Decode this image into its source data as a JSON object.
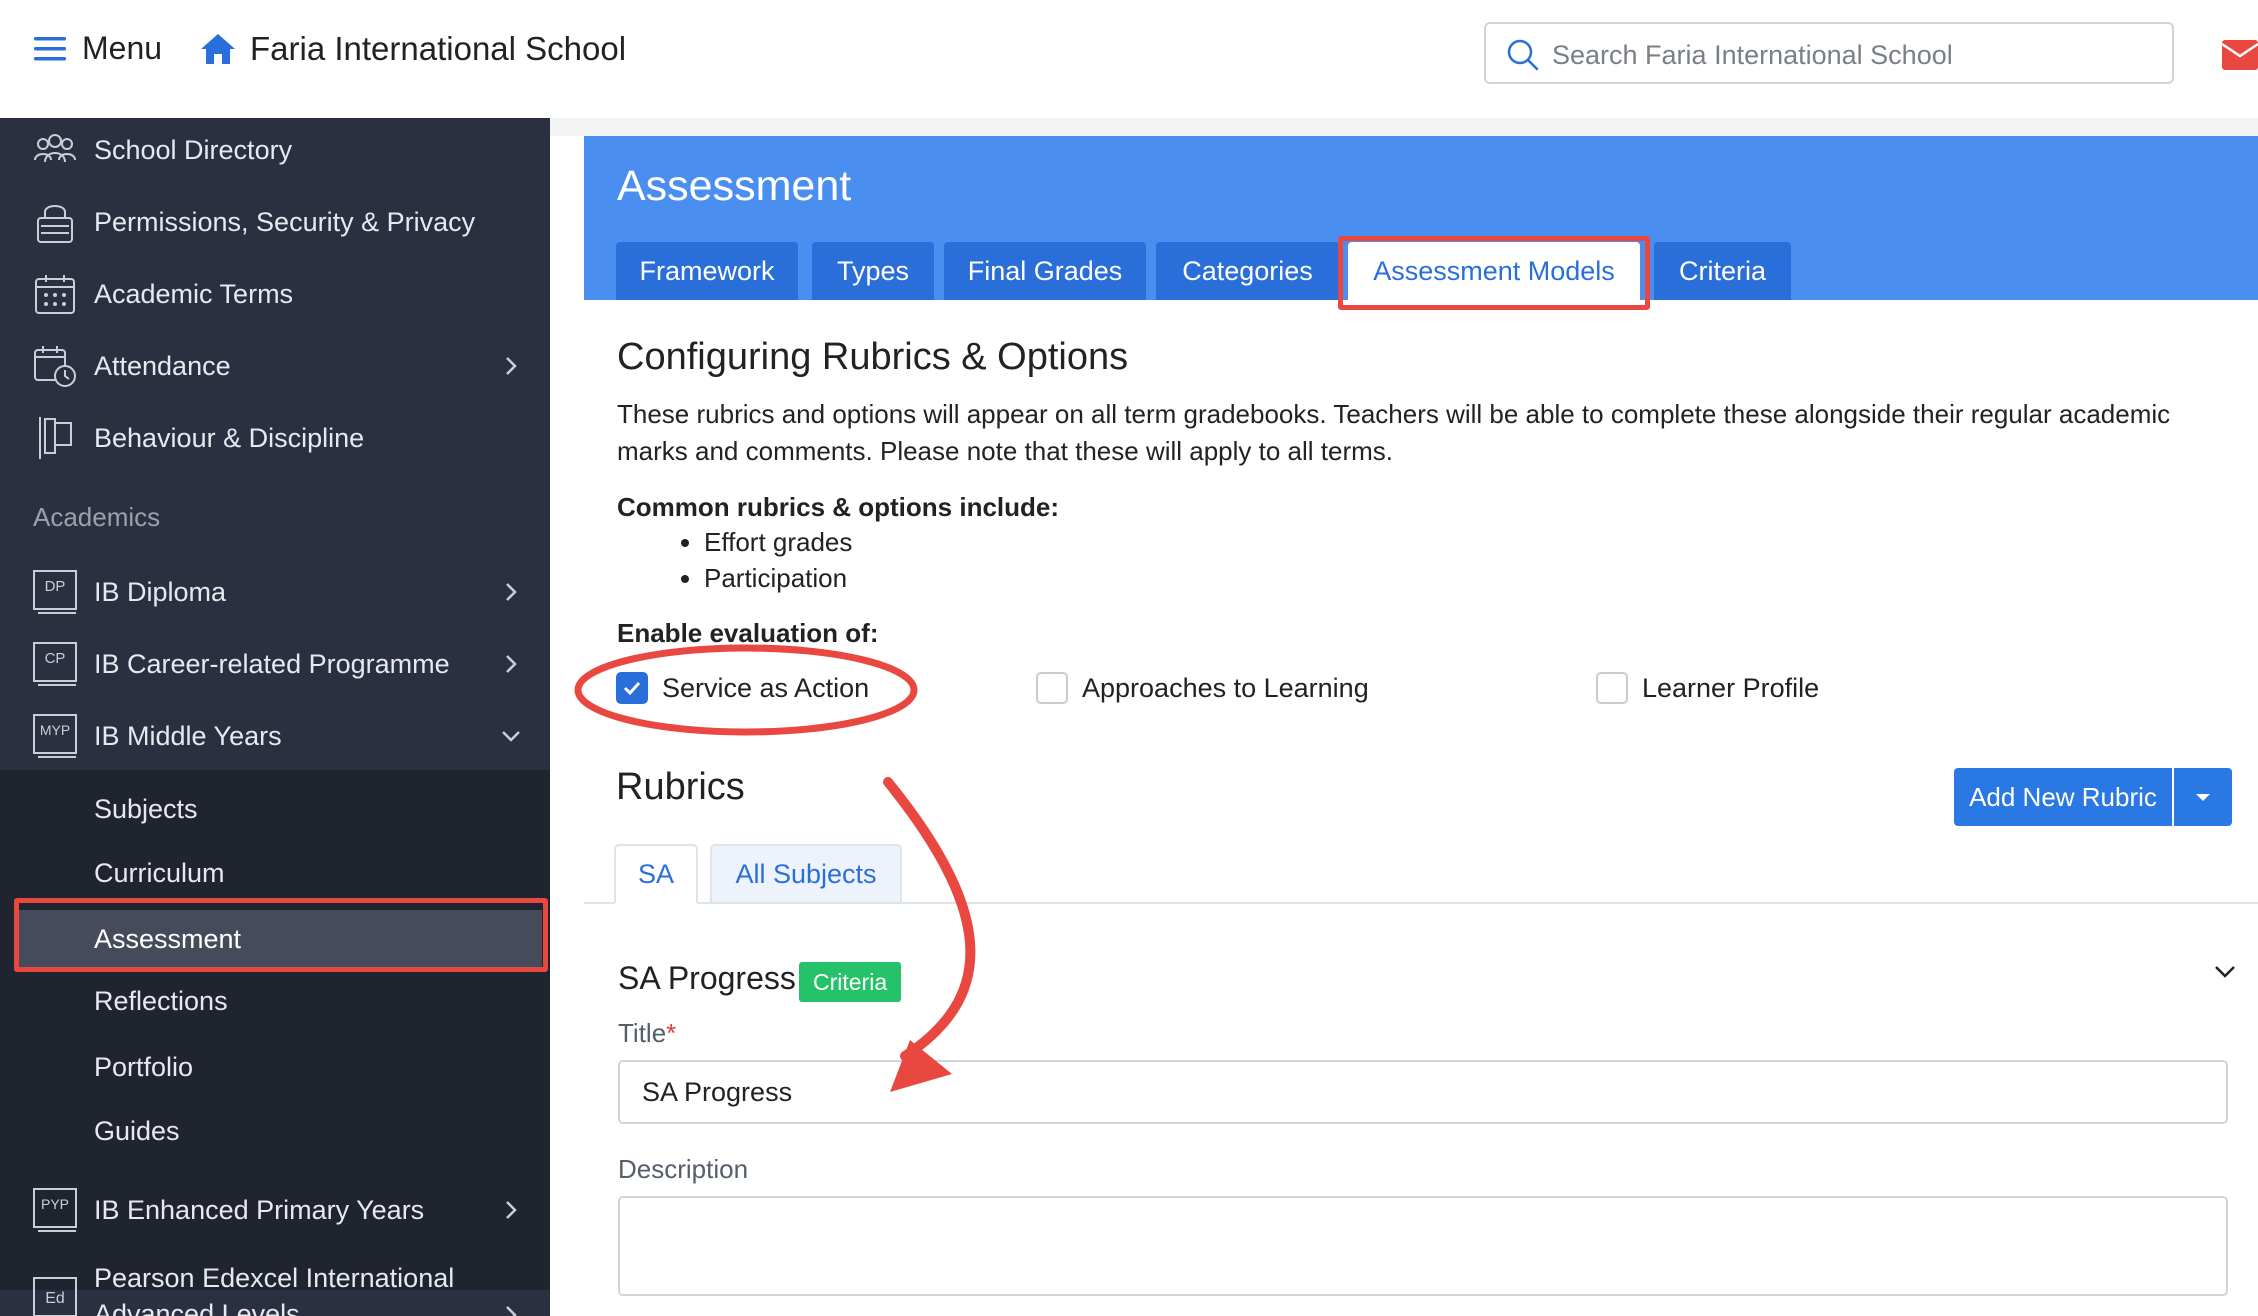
{
  "topbar": {
    "menu_label": "Menu",
    "school_name": "Faria International School",
    "search_placeholder": "Search Faria International School"
  },
  "sidebar": {
    "items_top": [
      {
        "label": "School Directory",
        "icon": "people-group-icon"
      },
      {
        "label": "Permissions, Security & Privacy",
        "icon": "lock-icon"
      },
      {
        "label": "Academic Terms",
        "icon": "calendar-icon"
      },
      {
        "label": "Attendance",
        "icon": "calendar-clock-icon"
      },
      {
        "label": "Behaviour & Discipline",
        "icon": "flag-icon"
      }
    ],
    "section_label": "Academics",
    "programmes": [
      {
        "label": "IB Diploma",
        "icon_text": "DP"
      },
      {
        "label": "IB Career-related Programme",
        "icon_text": "CP"
      },
      {
        "label": "IB Middle Years",
        "icon_text": "MYP"
      }
    ],
    "myp_subitems": [
      "Subjects",
      "Curriculum",
      "Assessment",
      "Reflections",
      "Portfolio",
      "Guides"
    ],
    "programmes_bottom": [
      {
        "label": "IB Enhanced Primary Years",
        "icon_text": "PYP"
      },
      {
        "label": "Pearson Edexcel International Advanced Levels",
        "icon_text": "Ed"
      }
    ]
  },
  "main": {
    "title": "Assessment",
    "tabs": [
      "Framework",
      "Types",
      "Final Grades",
      "Categories",
      "Assessment Models",
      "Criteria"
    ],
    "active_tab": "Assessment Models",
    "section_heading": "Configuring Rubrics & Options",
    "description": "These rubrics and options will appear on all term gradebooks. Teachers will be able to complete these alongside their regular academic marks and comments. Please note that these will apply to all terms.",
    "common_label": "Common rubrics & options include:",
    "common_items": [
      "Effort grades",
      "Participation"
    ],
    "enable_label": "Enable evaluation of:",
    "checkboxes": [
      {
        "label": "Service as Action",
        "checked": true
      },
      {
        "label": "Approaches to Learning",
        "checked": false
      },
      {
        "label": "Learner Profile",
        "checked": false
      }
    ],
    "rubrics_heading": "Rubrics",
    "add_rubric_label": "Add New Rubric",
    "rubric_tabs": [
      "SA",
      "All Subjects"
    ],
    "rubric": {
      "name": "SA Progress",
      "badge": "Criteria",
      "title_label": "Title",
      "required_mark": "*",
      "title_value": "SA Progress",
      "description_label": "Description",
      "description_value": ""
    }
  },
  "colors": {
    "sidebar_bg": "#2b3040",
    "header_blue": "#4a8ff0",
    "tab_blue": "#2a6fd9",
    "badge_green": "#25c26a",
    "annotation_red": "#e8483f"
  }
}
